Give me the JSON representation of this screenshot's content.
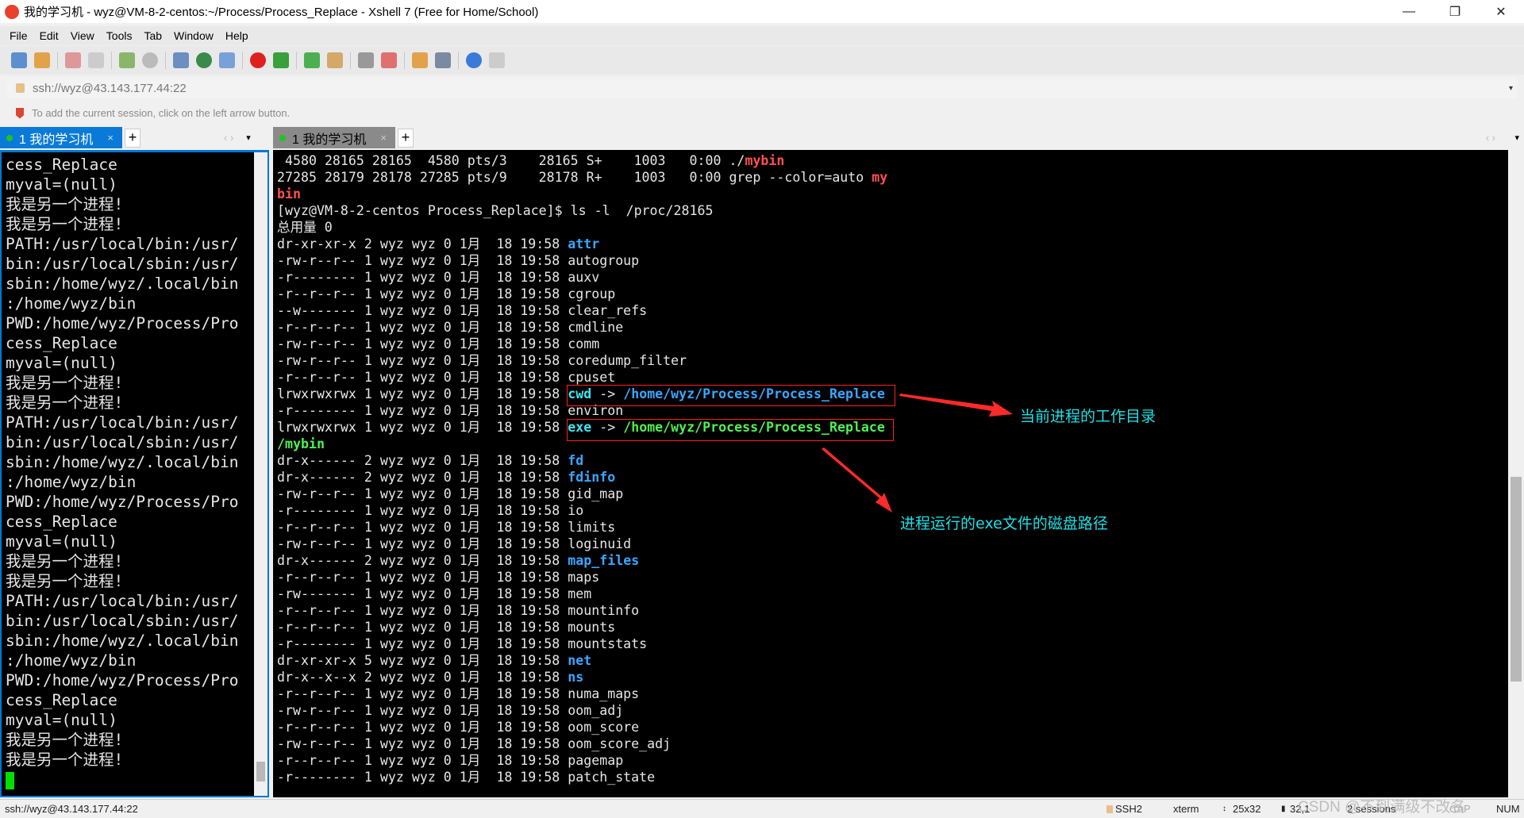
{
  "window": {
    "title": "我的学习机 - wyz@VM-8-2-centos:~/Process/Process_Replace - Xshell 7 (Free for Home/School)",
    "minimize": "—",
    "restore": "❐",
    "close": "✕"
  },
  "menu": [
    "File",
    "Edit",
    "View",
    "Tools",
    "Tab",
    "Window",
    "Help"
  ],
  "toolbar": {
    "icons": [
      "new-session",
      "open-folder",
      "disconnect",
      "reconnect",
      "properties",
      "find",
      "transfer",
      "globe",
      "font",
      "xshell",
      "xftp",
      "fullscreen",
      "lock",
      "keyboard",
      "highlight",
      "new-tab",
      "layout",
      "help",
      "chat"
    ]
  },
  "address": {
    "value": "ssh://wyz@43.143.177.44:22",
    "dropdown": "▾"
  },
  "hint": "To add the current session, click on the left arrow button.",
  "tabs": {
    "left": {
      "label": "1 我的学习机",
      "close": "×",
      "add": "+",
      "nav": "‹ ›",
      "menu": "▾"
    },
    "right": {
      "label": "1 我的学习机",
      "close": "×",
      "add": "+",
      "nav": "‹ ›",
      "menu": "▾"
    }
  },
  "left": {
    "lines": [
      "cess_Replace",
      "myval=(null)",
      "我是另一个进程!",
      "我是另一个进程!",
      "PATH:/usr/local/bin:/usr/",
      "bin:/usr/local/sbin:/usr/",
      "sbin:/home/wyz/.local/bin",
      ":/home/wyz/bin",
      "PWD:/home/wyz/Process/Pro",
      "cess_Replace",
      "myval=(null)",
      "我是另一个进程!",
      "我是另一个进程!",
      "PATH:/usr/local/bin:/usr/",
      "bin:/usr/local/sbin:/usr/",
      "sbin:/home/wyz/.local/bin",
      ":/home/wyz/bin",
      "PWD:/home/wyz/Process/Pro",
      "cess_Replace",
      "myval=(null)",
      "我是另一个进程!",
      "我是另一个进程!",
      "PATH:/usr/local/bin:/usr/",
      "bin:/usr/local/sbin:/usr/",
      "sbin:/home/wyz/.local/bin",
      ":/home/wyz/bin",
      "PWD:/home/wyz/Process/Pro",
      "cess_Replace",
      "myval=(null)",
      "我是另一个进程!",
      "我是另一个进程!"
    ]
  },
  "right": {
    "lines": [
      {
        "segs": [
          {
            "t": " 4580 28165 28165  4580 pts/3    28165 S+    1003   0:00 ./"
          },
          {
            "t": "mybin",
            "c": "red"
          }
        ]
      },
      {
        "segs": [
          {
            "t": "27285 28179 28178 27285 pts/9    28178 R+    1003   0:00 grep --color=auto "
          },
          {
            "t": "my",
            "c": "red"
          }
        ]
      },
      {
        "segs": [
          {
            "t": "bin",
            "c": "red"
          }
        ]
      },
      {
        "segs": [
          {
            "t": "[wyz@VM-8-2-centos Process_Replace]$ ls -l  /proc/28165"
          }
        ]
      },
      {
        "segs": [
          {
            "t": "总用量 0"
          }
        ]
      },
      {
        "segs": [
          {
            "t": "dr-xr-xr-x 2 wyz wyz 0 1月  18 19:58 "
          },
          {
            "t": "attr",
            "c": "dir"
          }
        ]
      },
      {
        "segs": [
          {
            "t": "-rw-r--r-- 1 wyz wyz 0 1月  18 19:58 autogroup"
          }
        ]
      },
      {
        "segs": [
          {
            "t": "-r-------- 1 wyz wyz 0 1月  18 19:58 auxv"
          }
        ]
      },
      {
        "segs": [
          {
            "t": "-r--r--r-- 1 wyz wyz 0 1月  18 19:58 cgroup"
          }
        ]
      },
      {
        "segs": [
          {
            "t": "--w------- 1 wyz wyz 0 1月  18 19:58 clear_refs"
          }
        ]
      },
      {
        "segs": [
          {
            "t": "-r--r--r-- 1 wyz wyz 0 1月  18 19:58 cmdline"
          }
        ]
      },
      {
        "segs": [
          {
            "t": "-rw-r--r-- 1 wyz wyz 0 1月  18 19:58 comm"
          }
        ]
      },
      {
        "segs": [
          {
            "t": "-rw-r--r-- 1 wyz wyz 0 1月  18 19:58 coredump_filter"
          }
        ]
      },
      {
        "segs": [
          {
            "t": "-r--r--r-- 1 wyz wyz 0 1月  18 19:58 cpuset"
          }
        ]
      },
      {
        "segs": [
          {
            "t": "lrwxrwxrwx 1 wyz wyz 0 1月  18 19:58 "
          },
          {
            "t": "cwd",
            "c": "cyan"
          },
          {
            "t": " -> "
          },
          {
            "t": "/home/wyz/Process/Process_Replace",
            "c": "dir"
          }
        ]
      },
      {
        "segs": [
          {
            "t": "-r-------- 1 wyz wyz 0 1月  18 19:58 environ"
          }
        ]
      },
      {
        "segs": [
          {
            "t": "lrwxrwxrwx 1 wyz wyz 0 1月  18 19:58 "
          },
          {
            "t": "exe",
            "c": "cyan"
          },
          {
            "t": " -> "
          },
          {
            "t": "/home/wyz/Process/Process_Replace",
            "c": "exe"
          }
        ]
      },
      {
        "segs": [
          {
            "t": "/mybin",
            "c": "exe"
          }
        ]
      },
      {
        "segs": [
          {
            "t": "dr-x------ 2 wyz wyz 0 1月  18 19:58 "
          },
          {
            "t": "fd",
            "c": "dir"
          }
        ]
      },
      {
        "segs": [
          {
            "t": "dr-x------ 2 wyz wyz 0 1月  18 19:58 "
          },
          {
            "t": "fdinfo",
            "c": "dir"
          }
        ]
      },
      {
        "segs": [
          {
            "t": "-rw-r--r-- 1 wyz wyz 0 1月  18 19:58 gid_map"
          }
        ]
      },
      {
        "segs": [
          {
            "t": "-r-------- 1 wyz wyz 0 1月  18 19:58 io"
          }
        ]
      },
      {
        "segs": [
          {
            "t": "-r--r--r-- 1 wyz wyz 0 1月  18 19:58 limits"
          }
        ]
      },
      {
        "segs": [
          {
            "t": "-rw-r--r-- 1 wyz wyz 0 1月  18 19:58 loginuid"
          }
        ]
      },
      {
        "segs": [
          {
            "t": "dr-x------ 2 wyz wyz 0 1月  18 19:58 "
          },
          {
            "t": "map_files",
            "c": "dir"
          }
        ]
      },
      {
        "segs": [
          {
            "t": "-r--r--r-- 1 wyz wyz 0 1月  18 19:58 maps"
          }
        ]
      },
      {
        "segs": [
          {
            "t": "-rw------- 1 wyz wyz 0 1月  18 19:58 mem"
          }
        ]
      },
      {
        "segs": [
          {
            "t": "-r--r--r-- 1 wyz wyz 0 1月  18 19:58 mountinfo"
          }
        ]
      },
      {
        "segs": [
          {
            "t": "-r--r--r-- 1 wyz wyz 0 1月  18 19:58 mounts"
          }
        ]
      },
      {
        "segs": [
          {
            "t": "-r-------- 1 wyz wyz 0 1月  18 19:58 mountstats"
          }
        ]
      },
      {
        "segs": [
          {
            "t": "dr-xr-xr-x 5 wyz wyz 0 1月  18 19:58 "
          },
          {
            "t": "net",
            "c": "dir"
          }
        ]
      },
      {
        "segs": [
          {
            "t": "dr-x--x--x 2 wyz wyz 0 1月  18 19:58 "
          },
          {
            "t": "ns",
            "c": "dir"
          }
        ]
      },
      {
        "segs": [
          {
            "t": "-r--r--r-- 1 wyz wyz 0 1月  18 19:58 numa_maps"
          }
        ]
      },
      {
        "segs": [
          {
            "t": "-rw-r--r-- 1 wyz wyz 0 1月  18 19:58 oom_adj"
          }
        ]
      },
      {
        "segs": [
          {
            "t": "-r--r--r-- 1 wyz wyz 0 1月  18 19:58 oom_score"
          }
        ]
      },
      {
        "segs": [
          {
            "t": "-rw-r--r-- 1 wyz wyz 0 1月  18 19:58 oom_score_adj"
          }
        ]
      },
      {
        "segs": [
          {
            "t": "-r--r--r-- 1 wyz wyz 0 1月  18 19:58 pagemap"
          }
        ]
      },
      {
        "segs": [
          {
            "t": "-r-------- 1 wyz wyz 0 1月  18 19:58 patch_state"
          }
        ]
      }
    ]
  },
  "annotations": {
    "cwd_note": "当前进程的工作目录",
    "exe_note": "进程运行的exe文件的磁盘路径"
  },
  "status": {
    "address": "ssh://wyz@43.143.177.44:22",
    "protocol": "SSH2",
    "term": "xterm",
    "size": "25x32",
    "cursor": "32,1",
    "sessions": "2 sessions",
    "caps": "CAP",
    "num": "NUM",
    "watermark": "CSDN @不到满级不改名"
  },
  "colors": {
    "accent": "#0078d7",
    "dir": "#3aa6ff",
    "link": "#3ee6f0",
    "exe": "#50f050",
    "grep": "#ff5050",
    "annotation": "#1ee0e6",
    "box": "#ff2020"
  }
}
